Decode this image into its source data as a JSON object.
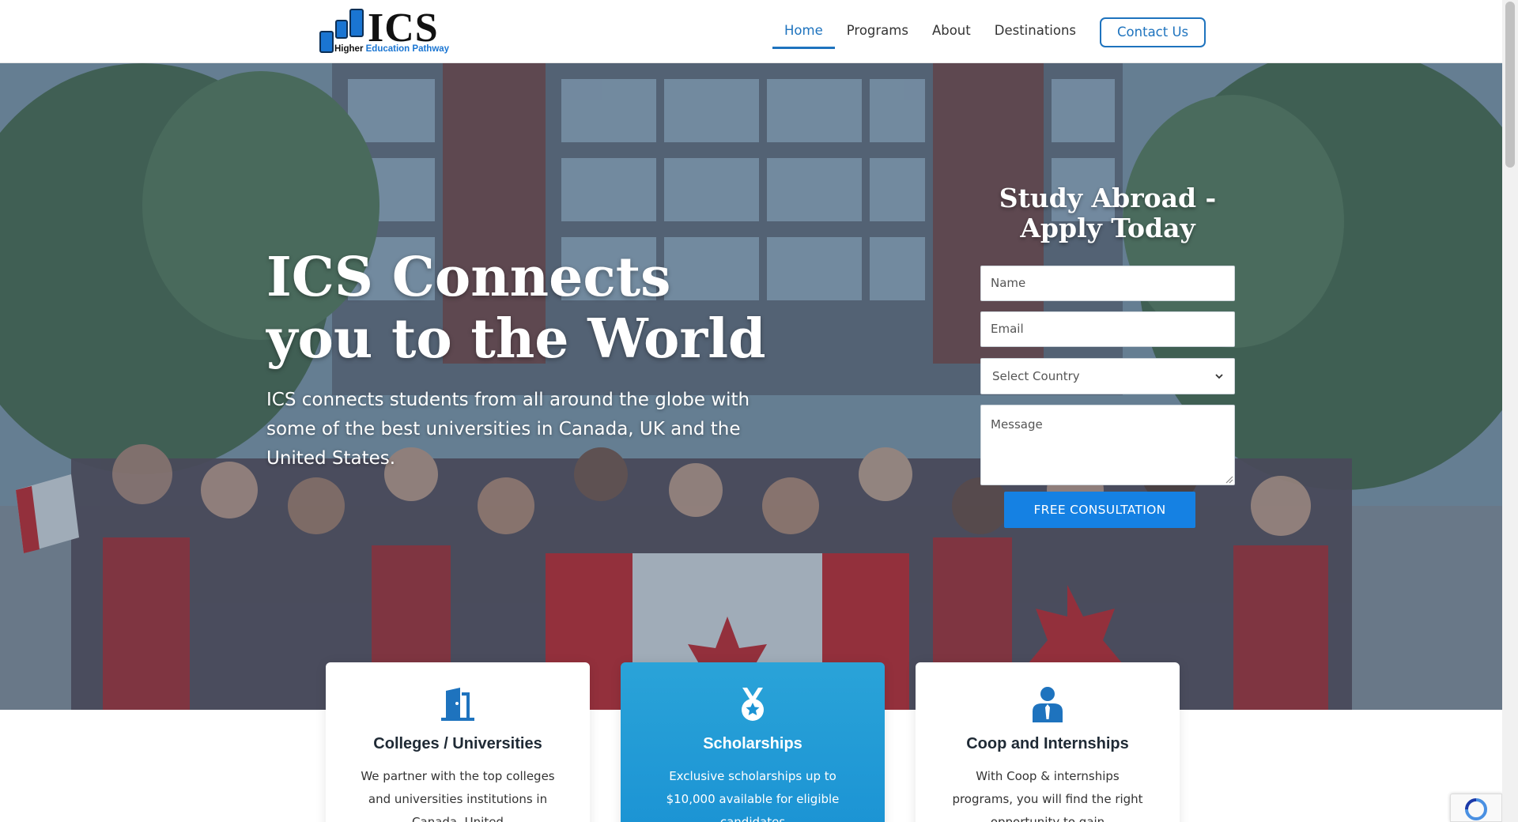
{
  "logo": {
    "text": "ICS",
    "sub_left": "Higher ",
    "sub_right": "Education Pathway"
  },
  "nav": {
    "items": [
      {
        "label": "Home",
        "active": true
      },
      {
        "label": "Programs",
        "active": false
      },
      {
        "label": "About",
        "active": false
      },
      {
        "label": "Destinations",
        "active": false
      }
    ],
    "contact_label": "Contact Us"
  },
  "hero": {
    "title": "ICS Connects you to the World",
    "subtitle": "ICS connects students from all around the globe with some of the best universities in Canada, UK and the United States."
  },
  "form": {
    "title": "Study Abroad - Apply Today",
    "name_placeholder": "Name",
    "email_placeholder": "Email",
    "country_selected": "Select Country",
    "message_placeholder": "Message",
    "submit_label": "FREE CONSULTATION"
  },
  "cards": [
    {
      "title": "Colleges / Universities",
      "text": "We partner with the top colleges and universities institutions in Canada, United",
      "icon": "door-icon"
    },
    {
      "title": "Scholarships",
      "text": "Exclusive scholarships up to $10,000 available for eligible candidates",
      "icon": "medal-icon"
    },
    {
      "title": "Coop and Internships",
      "text": "With Coop & internships programs, you will find the right opportunity to gain",
      "icon": "person-tie-icon"
    }
  ],
  "colors": {
    "brand_blue": "#1e73be",
    "button_blue": "#1581e3",
    "card_featured": "#1b93d4"
  }
}
